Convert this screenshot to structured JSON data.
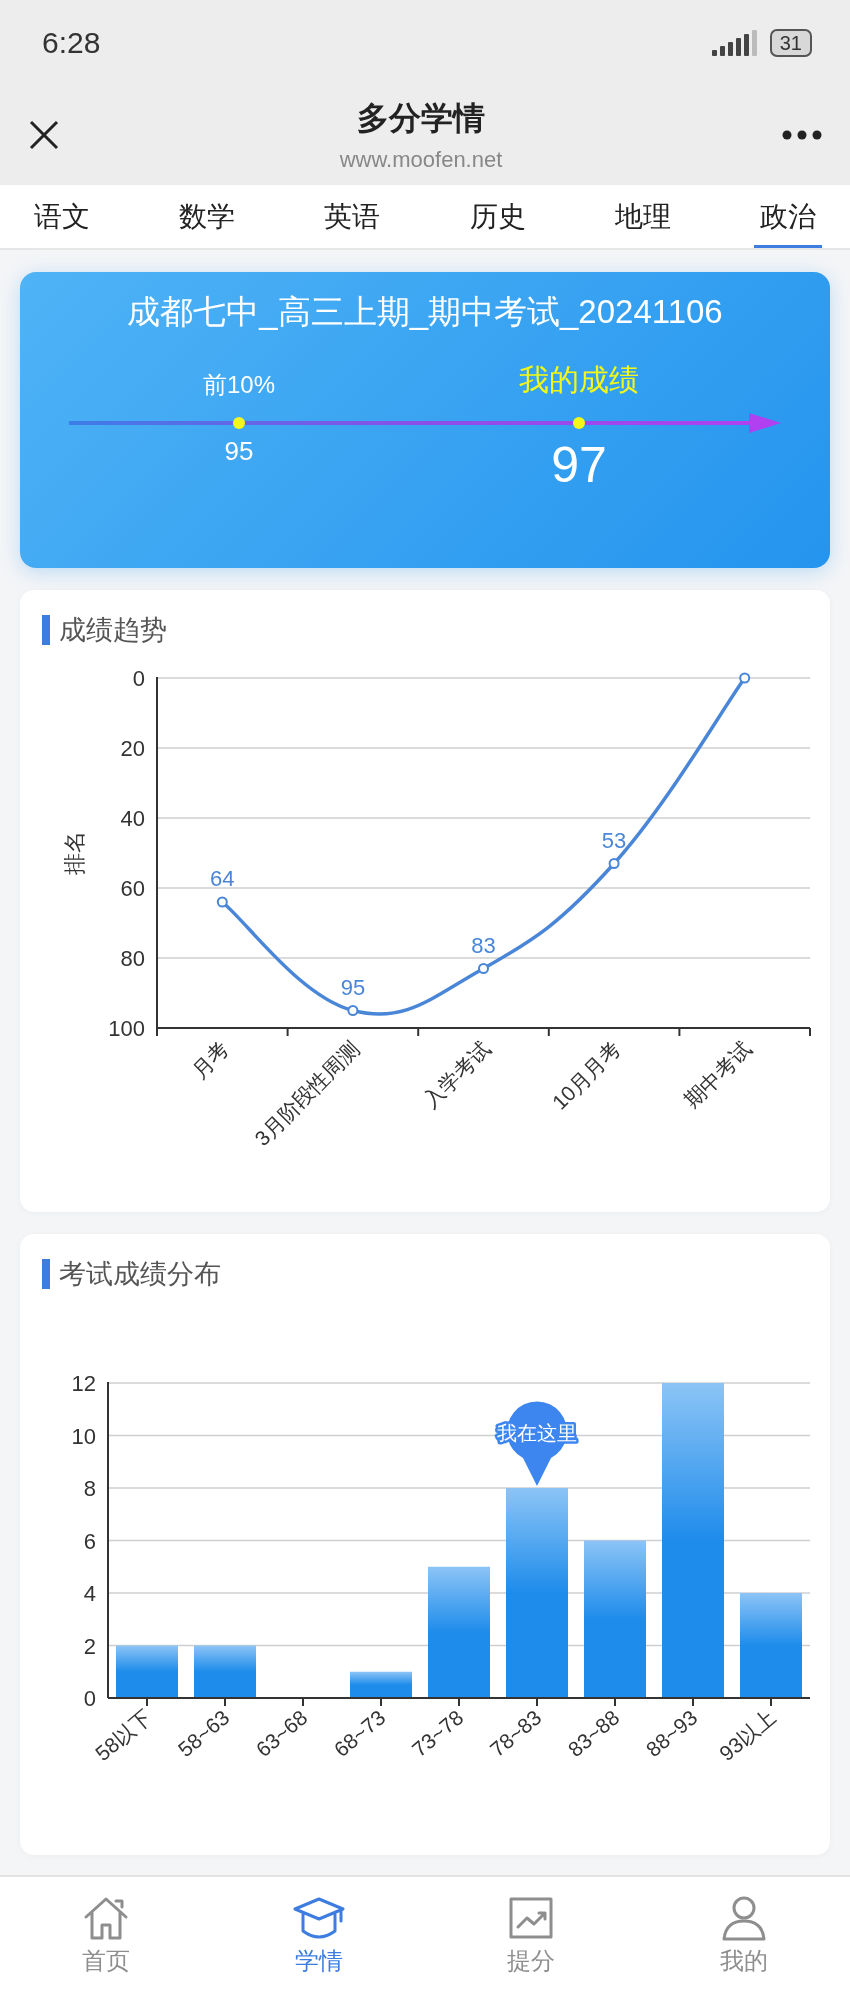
{
  "status_bar": {
    "time": "6:28",
    "battery": "31"
  },
  "header": {
    "title": "多分学情",
    "url": "www.moofen.net"
  },
  "tabs": [
    {
      "label": "语文",
      "selected": false
    },
    {
      "label": "数学",
      "selected": false
    },
    {
      "label": "英语",
      "selected": false
    },
    {
      "label": "历史",
      "selected": false
    },
    {
      "label": "地理",
      "selected": false
    },
    {
      "label": "政治",
      "selected": true
    }
  ],
  "score_card": {
    "title": "成都七中_高三上期_期中考试_20241106",
    "benchmark_label": "前10%",
    "benchmark_value": "95",
    "mine_label": "我的成绩",
    "mine_value": "97"
  },
  "trend": {
    "title": "成绩趋势",
    "chart_data": {
      "type": "line",
      "ylabel": "排名",
      "categories": [
        "月考",
        "3月阶段性周测",
        "入学考试",
        "10月月考",
        "期中考试"
      ],
      "series": [
        {
          "color": "#4a86d8",
          "marker": true,
          "values": [
            64,
            95,
            83,
            53,
            0
          ]
        }
      ],
      "grid": true,
      "ylim": [
        100,
        0
      ],
      "yticks": [
        0,
        20,
        40,
        60,
        80,
        100
      ],
      "value_labels": [
        "64",
        "95",
        "83",
        "53"
      ]
    }
  },
  "distribution": {
    "title": "考试成绩分布",
    "chart_data": {
      "type": "bar",
      "categories": [
        "58以下",
        "58~63",
        "63~68",
        "68~73",
        "73~78",
        "78~83",
        "83~88",
        "88~93",
        "93以上"
      ],
      "series": [
        {
          "color": "#1e8ceb",
          "values": [
            2,
            2,
            0,
            1,
            5,
            8,
            6,
            12,
            4
          ]
        }
      ],
      "grid": true,
      "ylim": [
        0,
        12
      ],
      "yticks": [
        0,
        2,
        4,
        6,
        8,
        10,
        12
      ],
      "annotations": [
        {
          "x": "78~83",
          "y": 8,
          "text": "我在这里"
        }
      ]
    }
  },
  "bottom_nav": [
    {
      "label": "首页",
      "kind": "home",
      "selected": false
    },
    {
      "label": "学情",
      "kind": "study",
      "selected": true
    },
    {
      "label": "提分",
      "kind": "improve",
      "selected": false
    },
    {
      "label": "我的",
      "kind": "me",
      "selected": false
    }
  ]
}
